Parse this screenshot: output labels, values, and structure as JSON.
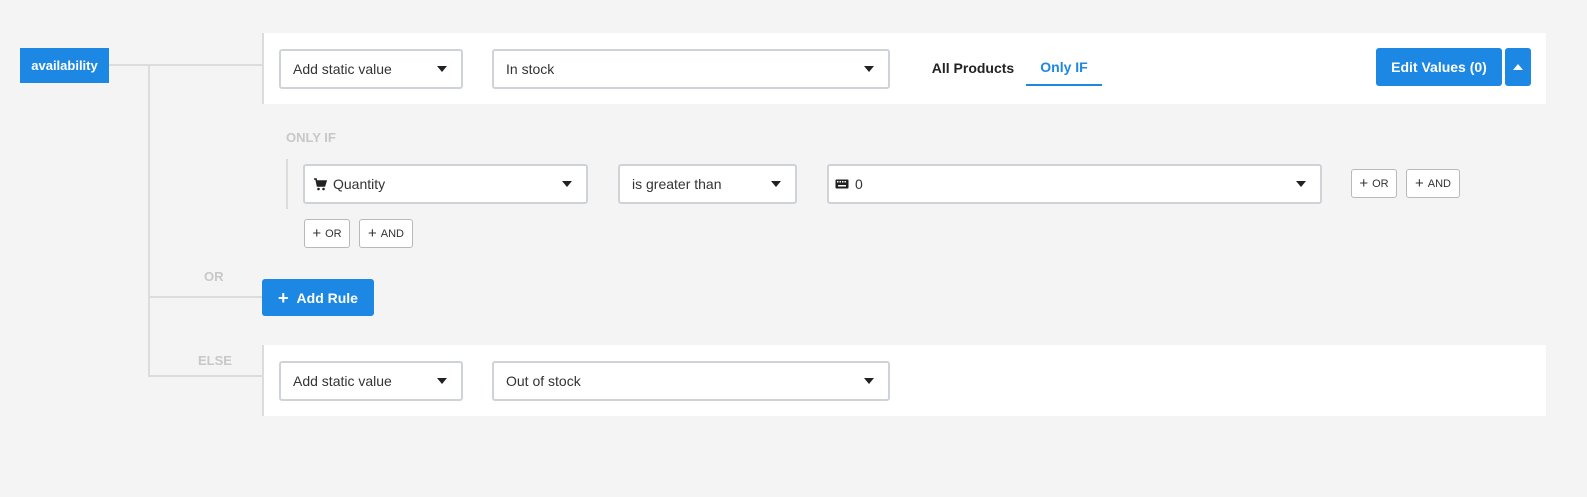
{
  "field": {
    "name": "availability"
  },
  "rule": {
    "value_type_select": "Add static value",
    "value_select": "In stock",
    "tabs": [
      {
        "label": "All Products",
        "active": false
      },
      {
        "label": "Only IF",
        "active": true
      }
    ],
    "edit_values_button": "Edit Values (0)"
  },
  "condition": {
    "section_label": "ONLY IF",
    "attribute_select": "Quantity",
    "attribute_icon": "cart-icon",
    "operator_select": "is greater than",
    "value_input": "0",
    "value_icon": "keyboard-icon",
    "or_label": "OR",
    "and_label": "AND"
  },
  "group_actions": {
    "or_label": "OR",
    "and_label": "AND"
  },
  "or_connector": {
    "label": "OR",
    "add_rule_button": "Add Rule"
  },
  "else_rule": {
    "label": "ELSE",
    "value_type_select": "Add static value",
    "value_select": "Out of stock"
  },
  "colors": {
    "accent": "#1d87e4",
    "connector": "#dcdcdc"
  }
}
